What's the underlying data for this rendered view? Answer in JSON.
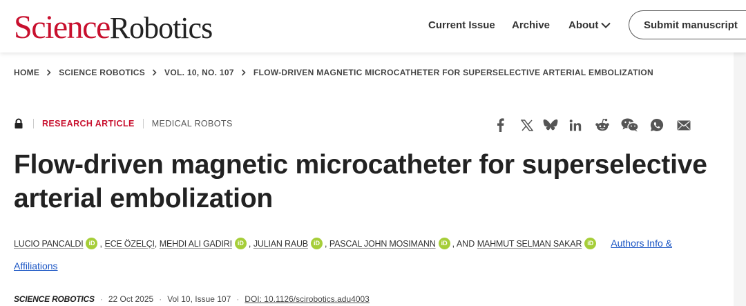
{
  "header": {
    "logo": {
      "science": "Science",
      "robotics": "Robotics"
    },
    "nav": {
      "current_issue": "Current Issue",
      "archive": "Archive",
      "about": "About"
    },
    "submit_label": "Submit manuscript"
  },
  "breadcrumb": [
    {
      "label": "HOME"
    },
    {
      "label": "SCIENCE ROBOTICS"
    },
    {
      "label": "VOL. 10, NO. 107"
    },
    {
      "label": "FLOW-DRIVEN MAGNETIC MICROCATHETER FOR SUPERSELECTIVE ARTERIAL EMBOLIZATION"
    }
  ],
  "article": {
    "access_icon": "lock-icon",
    "type": "RESEARCH ARTICLE",
    "subject": "MEDICAL ROBOTS",
    "title_line1": "Flow-driven magnetic microcatheter for superselective",
    "title_line2": "arterial embolization",
    "authors": [
      "LUCIO PANCALDI",
      "ECE ÖZELÇI",
      "MEHDI ALI GADIRI",
      "JULIAN RAUB",
      "PASCAL JOHN MOSIMANN",
      "MAHMUT SELMAN SAKAR"
    ],
    "orcid_label": "iD",
    "and_label": ", AND",
    "comma": ",",
    "authors_info_part1": "Authors Info &",
    "authors_info_part2": "Affiliations"
  },
  "share_icons": [
    "facebook-icon",
    "x-icon",
    "bluesky-icon",
    "linkedin-icon",
    "reddit-icon",
    "wechat-icon",
    "whatsapp-icon",
    "email-icon"
  ],
  "citation": {
    "journal": "SCIENCE ROBOTICS",
    "date": "22 Oct 2025",
    "volume": "Vol 10, Issue 107",
    "doi": "DOI: 10.1126/scirobotics.adu4003"
  },
  "colors": {
    "brand_red": "#c8102e",
    "link_blue": "#1a55c4",
    "orcid_green": "#a6ce39"
  }
}
